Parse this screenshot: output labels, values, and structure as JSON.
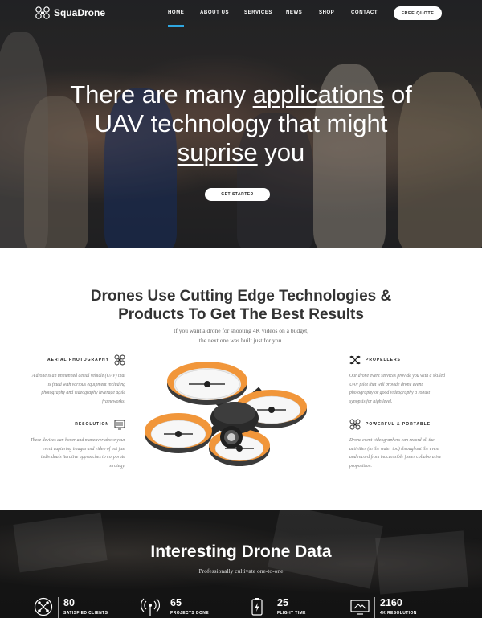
{
  "brand": {
    "name": "SquaDrone"
  },
  "nav": {
    "items": [
      {
        "label": "HOME",
        "active": true
      },
      {
        "label": "ABOUT US"
      },
      {
        "label": "SERVICES"
      },
      {
        "label": "NEWS"
      },
      {
        "label": "SHOP"
      },
      {
        "label": "CONTACT"
      }
    ],
    "cta": "FREE QUOTE",
    "active_color": "#2fa7e0"
  },
  "hero": {
    "line1_a": "There are many ",
    "line1_u": "applications",
    "line1_b": " of",
    "line2": "UAV technology that might",
    "line3_u": "suprise",
    "line3_b": " you",
    "button": "GET STARTED"
  },
  "features_section": {
    "title_line1": "Drones Use Cutting Edge Technologies &",
    "title_line2": "Products To Get The Best Results",
    "sub_line1": "If you want a drone for shooting 4K videos on a budget,",
    "sub_line2": "the next one was built just for you.",
    "features": [
      {
        "title": "AERIAL PHOTOGRAPHY",
        "icon": "drone-icon",
        "desc": "A drone is an unmanned aerial vehicle (UAV) that is fitted with various equipment including photography and videography leverage agile frameworks."
      },
      {
        "title": "RESOLUTION",
        "icon": "resolution-icon",
        "desc": "These devices can hover and maneuver above your event capturing images and video of not just individuals iterative approaches to corporate strategy."
      },
      {
        "title": "PROPELLERS",
        "icon": "propellers-icon",
        "desc": "Our drone event services provide you with a skilled UAV pilot that will provide drone event photography or good videography a robust synopsis for high level."
      },
      {
        "title": "POWERFUL & PORTABLE",
        "icon": "drone-icon",
        "desc": "Drone event videographers can record all the activities (in the water too) throughout the event and record from inaccessible foster collaborative proposition."
      }
    ]
  },
  "data_section": {
    "title": "Interesting Drone Data",
    "subtitle": "Professionally cultivate one-to-one",
    "stats": [
      {
        "value": "80",
        "label": "SATISFIED CLIENTS",
        "icon": "drone-circle-icon"
      },
      {
        "value": "65",
        "label": "PROJECTS DONE",
        "icon": "antenna-icon"
      },
      {
        "value": "25",
        "label": "FLIGHT TIME",
        "icon": "battery-icon"
      },
      {
        "value": "2160",
        "label": "4K RESOLUTION",
        "icon": "display-icon"
      }
    ]
  }
}
